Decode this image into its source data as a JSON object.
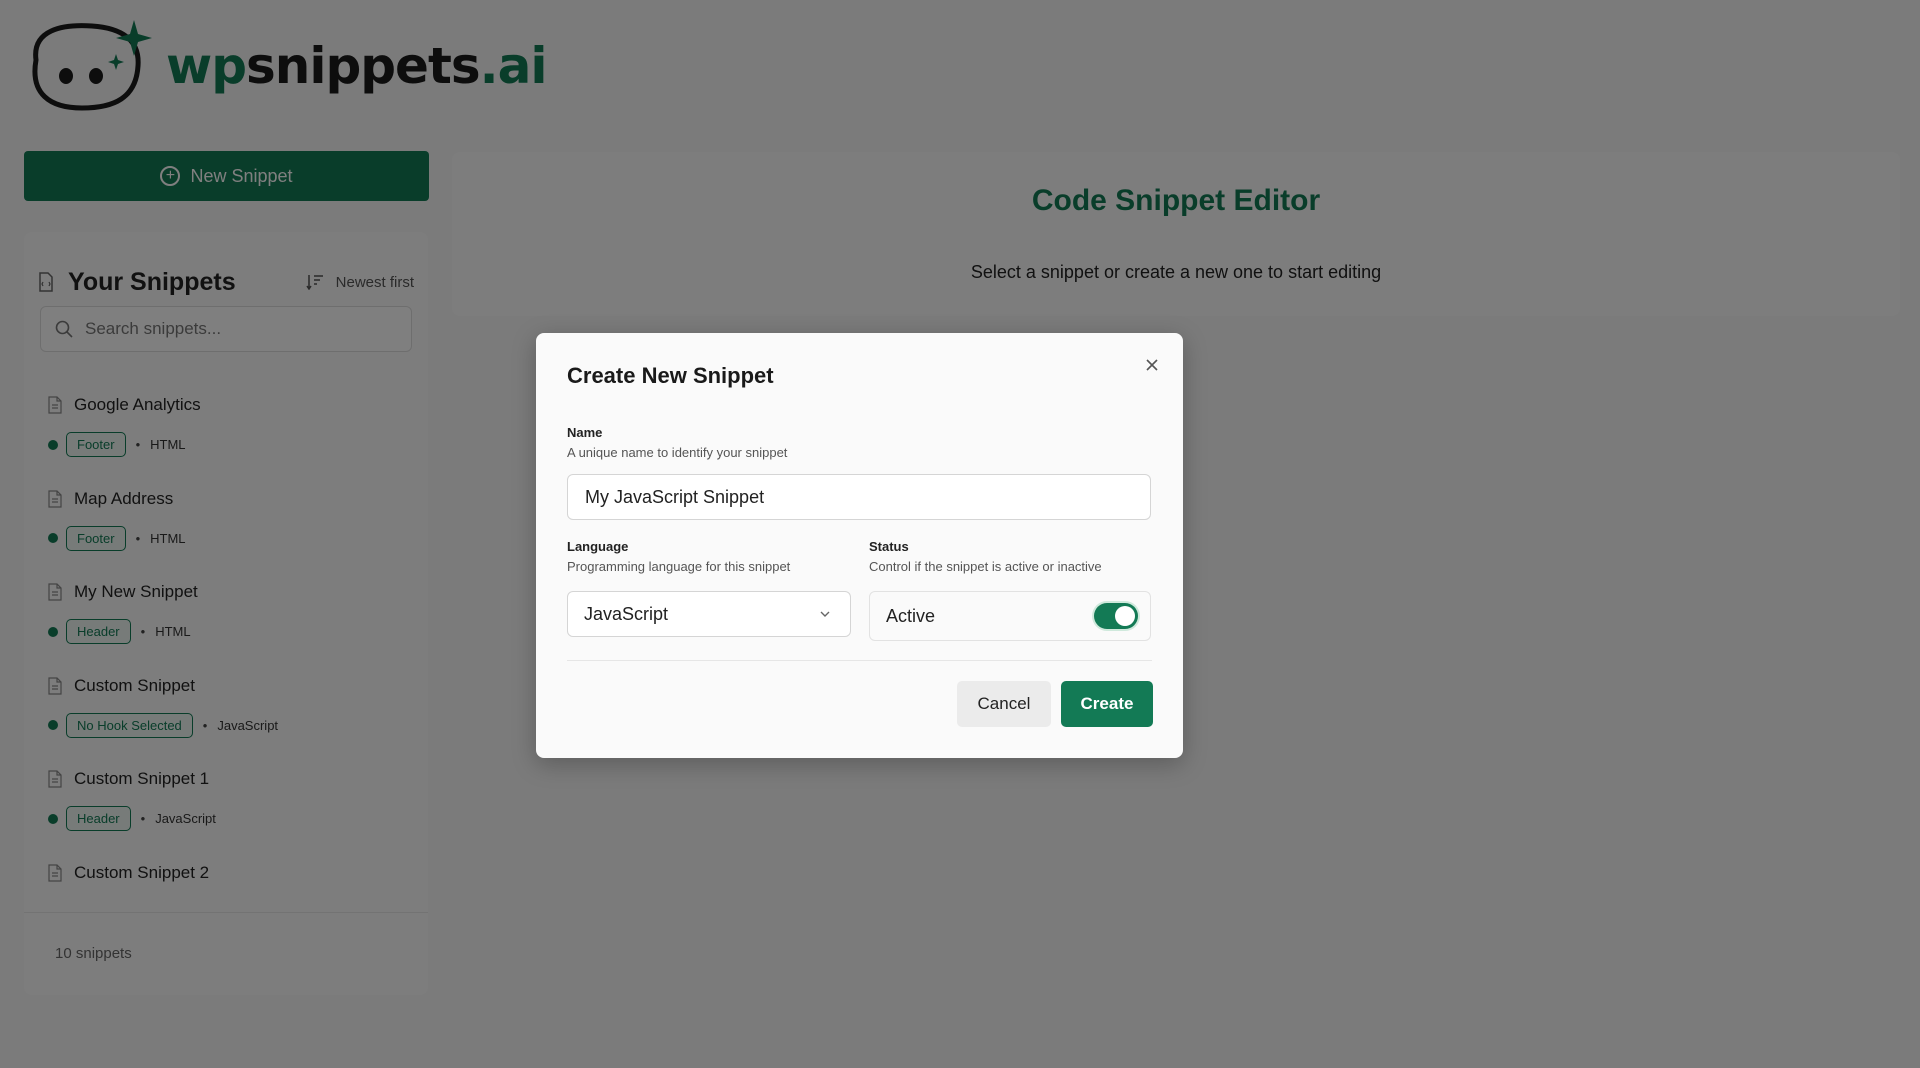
{
  "brand": {
    "prefix": "wp",
    "middle": "snippets",
    "suffix": ".ai"
  },
  "new_button": {
    "label": "New Snippet",
    "icon": "plus-circle-icon"
  },
  "sidebar": {
    "title": "Your Snippets",
    "sort_label": "Newest first",
    "search_placeholder": "Search snippets...",
    "items": [
      {
        "name": "Google Analytics",
        "hook": "Footer",
        "language": "HTML"
      },
      {
        "name": "Map Address",
        "hook": "Footer",
        "language": "HTML"
      },
      {
        "name": "My New Snippet",
        "hook": "Header",
        "language": "HTML"
      },
      {
        "name": "Custom Snippet",
        "hook": "No Hook Selected",
        "language": "JavaScript"
      },
      {
        "name": "Custom Snippet 1",
        "hook": "Header",
        "language": "JavaScript"
      },
      {
        "name": "Custom Snippet 2"
      }
    ],
    "count": "10 snippets"
  },
  "editor": {
    "title": "Code Snippet Editor",
    "subtitle": "Select a snippet or create a new one to start editing"
  },
  "modal": {
    "title": "Create New Snippet",
    "name_label": "Name",
    "name_help": "A unique name to identify your snippet",
    "name_value": "My JavaScript Snippet",
    "language_label": "Language",
    "language_help": "Programming language for this snippet",
    "language_value": "JavaScript",
    "status_label": "Status",
    "status_help": "Control if the snippet is active or inactive",
    "status_value": "Active",
    "cancel_label": "Cancel",
    "create_label": "Create"
  },
  "colors": {
    "accent": "#137a55",
    "overlay": "rgba(0,0,0,0.5)"
  }
}
